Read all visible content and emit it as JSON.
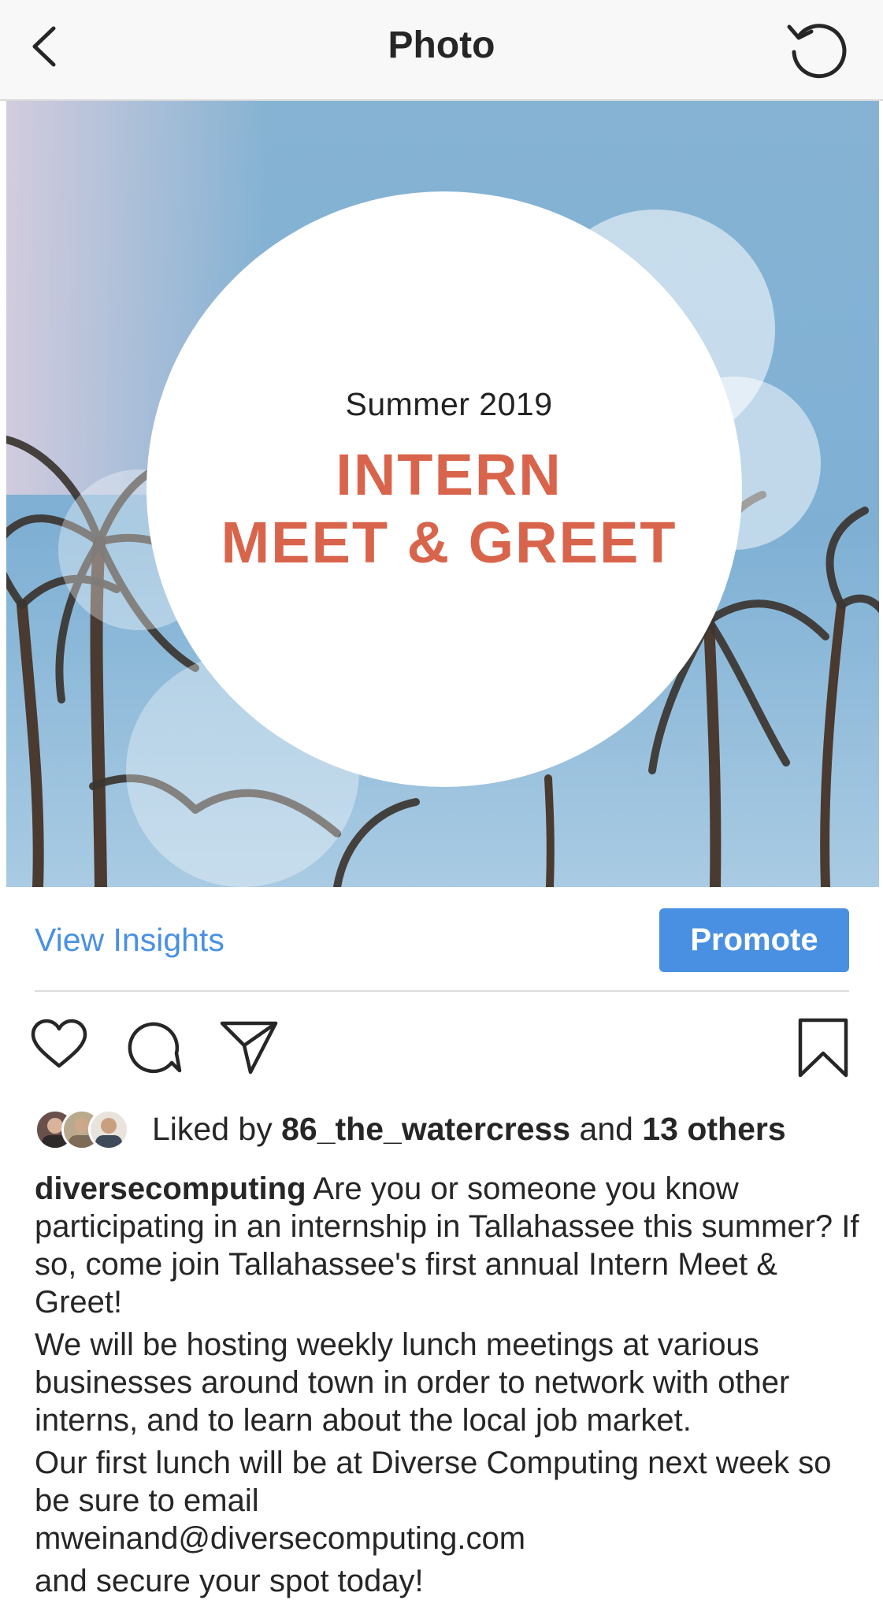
{
  "header": {
    "title": "Photo",
    "back_icon": "chevron-left-icon",
    "refresh_icon": "refresh-icon"
  },
  "photo": {
    "subtitle": "Summer 2019",
    "headline_line1": "INTERN",
    "headline_line2": "MEET & GREET",
    "headline_color": "#d9644c",
    "sky_color": "#7fb0d4"
  },
  "insights": {
    "view_label": "View Insights",
    "promote_label": "Promote",
    "accent_color": "#4a90e2"
  },
  "actions": {
    "like_icon": "heart-icon",
    "comment_icon": "comment-icon",
    "share_icon": "paper-plane-icon",
    "save_icon": "bookmark-icon"
  },
  "likes": {
    "prefix": "Liked by",
    "user": "86_the_watercress",
    "connector": "and",
    "others": "13 others"
  },
  "caption": {
    "username": "diversecomputing",
    "paragraph1": "Are you or someone you know participating in an internship in Tallahassee this summer? If so, come join Tallahassee's first annual Intern Meet & Greet!",
    "paragraph2": "We will be hosting weekly lunch meetings at various businesses around town in order to network with other interns, and to learn about the local job market.",
    "paragraph3_line1": "Our first lunch will be at Diverse Computing next week so be sure to email",
    "paragraph3_email": "mweinand@diversecomputing.com",
    "paragraph4": "and secure your spot today!"
  }
}
